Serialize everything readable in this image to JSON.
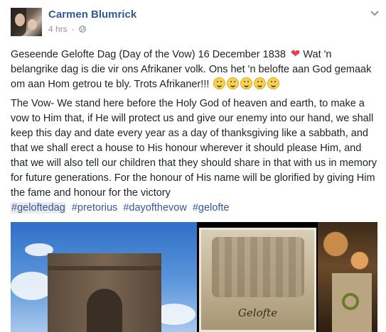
{
  "post": {
    "author": "Carmen Blumrick",
    "time": "4 hrs",
    "privacy_icon": "globe-icon",
    "menu_icon": "chevron-down-icon",
    "paragraph1_a": "Geseende Gelofte Dag (Day of the Vow) 16 December 1838",
    "paragraph1_b": "Wat 'n belangrike dag is die vir ons Afrikaner volk. Ons het 'n belofte aan God gemaak om aan Hom getrou te bly. Trots Afrikaner!!!",
    "paragraph2": "The Vow- We stand here before the Holy God of heaven and earth, to make a vow to Him that, if He will protect us and give our enemy into our hand, we shall keep this day and date every year as a day of thanksgiving like a sabbath, and that we shall erect a house to His honour wherever it should please Him, and that we will also tell our children that they should share in that with us in memory for future generations. For the honour of His name will be glorified by giving Him the fame and honour for the victory",
    "hashtags": [
      "#geloftedag",
      "#pretorius",
      "#dayofthevow",
      "#gelofte"
    ],
    "image_caption": "Gelofte"
  },
  "colors": {
    "link": "#365899",
    "text": "#1d2129",
    "meta": "#90949c"
  }
}
